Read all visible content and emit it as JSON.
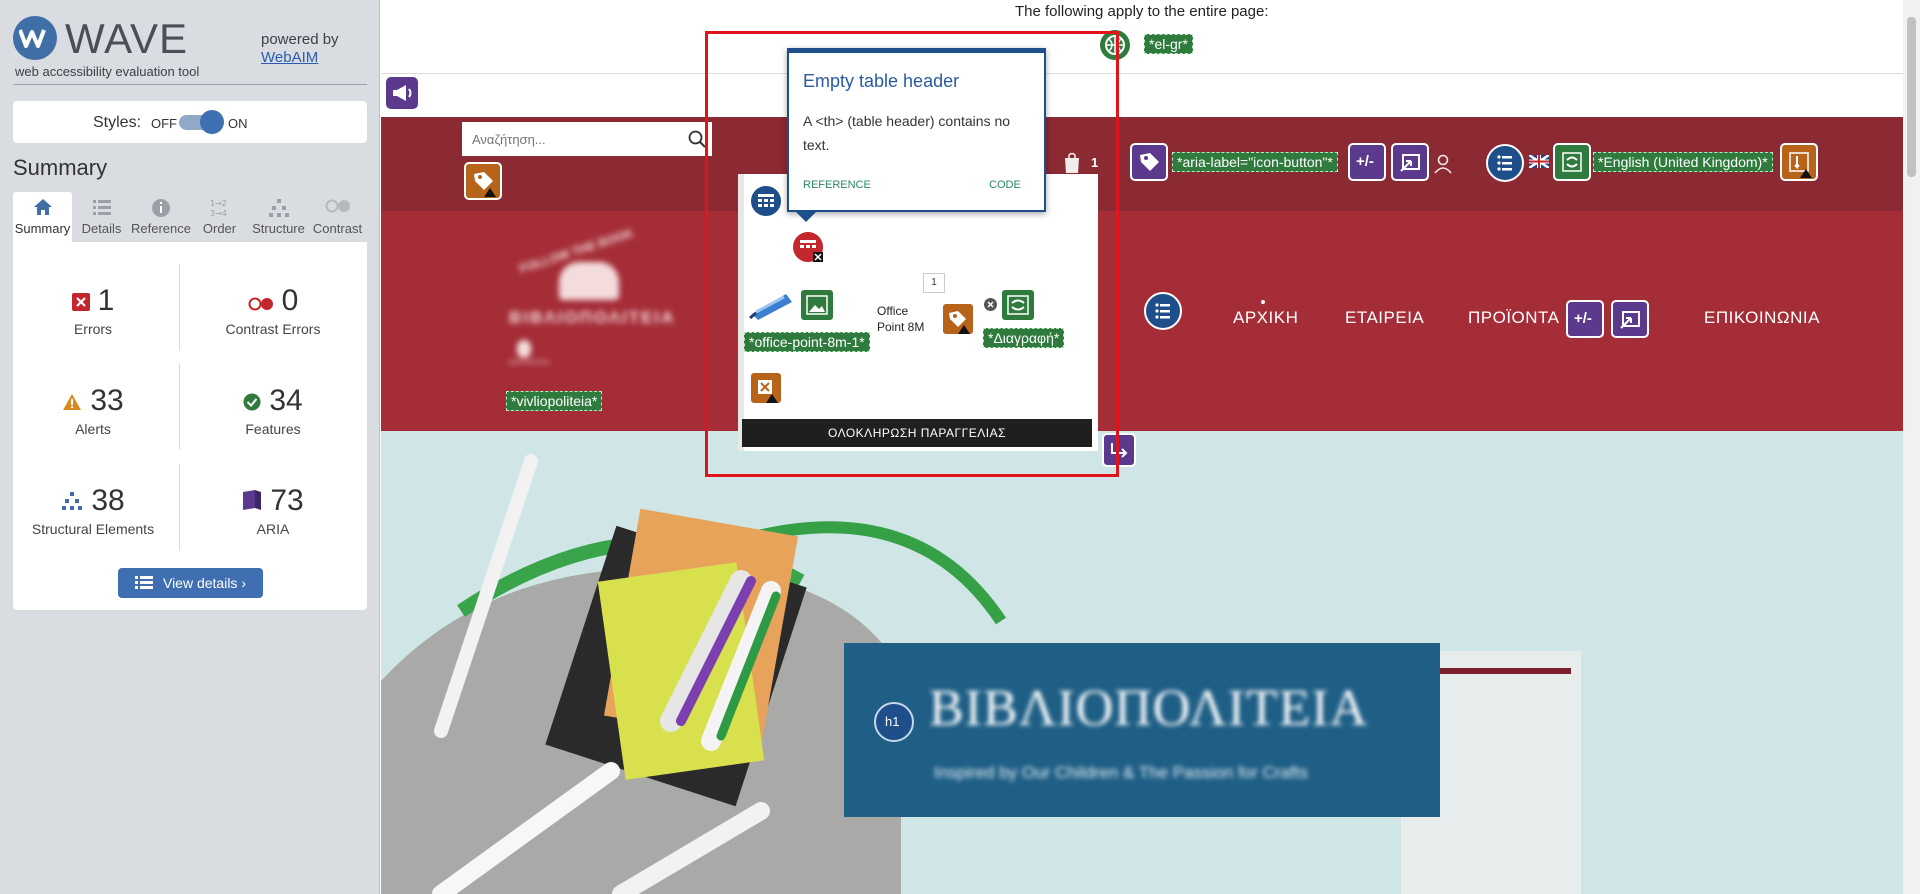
{
  "wave": {
    "title": "WAVE",
    "subtitle": "web accessibility evaluation tool",
    "powered_by": "powered by",
    "webaim_link": "WebAIM",
    "styles_label": "Styles:",
    "styles_off": "OFF",
    "styles_on": "ON",
    "summary_heading": "Summary",
    "tabs": [
      "Summary",
      "Details",
      "Reference",
      "Order",
      "Structure",
      "Contrast"
    ],
    "active_tab": "Summary",
    "stats": {
      "errors": {
        "value": "1",
        "label": "Errors"
      },
      "contrast": {
        "value": "0",
        "label": "Contrast Errors"
      },
      "alerts": {
        "value": "33",
        "label": "Alerts"
      },
      "features": {
        "value": "34",
        "label": "Features"
      },
      "structural": {
        "value": "38",
        "label": "Structural Elements"
      },
      "aria": {
        "value": "73",
        "label": "ARIA"
      }
    },
    "view_details": "View details ›",
    "colors": {
      "primary": "#3f6fb0",
      "error": "#c4262e",
      "alert": "#d98b1d",
      "feature": "#2f7a3d",
      "aria": "#5b3a8e"
    }
  },
  "page": {
    "apply_note": "The following apply to the entire page:",
    "badges": {
      "lang": "*el-gr*",
      "aria_label": "*aria-label=\"icon-button\"*",
      "english": "*English (United Kingdom)*",
      "office_point": "*office-point-8m-1*",
      "delete": "*Διαγραφή*",
      "vivliopoliteia": "*vivliopoliteia*"
    },
    "search": {
      "placeholder": "Αναζήτηση..."
    },
    "cart": {
      "count": "1",
      "qty": "1",
      "product_name": "Office Point 8M",
      "checkout": "ΟΛΟΚΛΗΡΩΣΗ ΠΑΡΑΓΓΕΛΙΑΣ"
    },
    "nav": [
      "ΑΡΧΙΚΗ",
      "ΕΤΑΙΡΕΙΑ",
      "ΠΡΟΪΟΝΤΑ",
      "ΕΠΙΚΟΙΝΩΝΙΑ"
    ],
    "logo": {
      "text": "ΒΙΒΛΙΟΠΟΛΙΤΕΙΑ",
      "arc": "FOLLOW THE BOOK",
      "small": "ΒΙΒΛΙΟΠΟΛΙΤΕΙΑ"
    },
    "banner": {
      "title": "ΒΙΒΛΙΟΠΟΛΙΤΕΙΑ",
      "subtitle": "Inspired by Our Children & The Passion for Crafts"
    },
    "tooltip": {
      "title": "Empty table header",
      "body": "A <th> (table header) contains no text.",
      "reference": "REFERENCE",
      "code": "CODE"
    },
    "h1_badge": "h1",
    "plus_minus": "+/-"
  }
}
